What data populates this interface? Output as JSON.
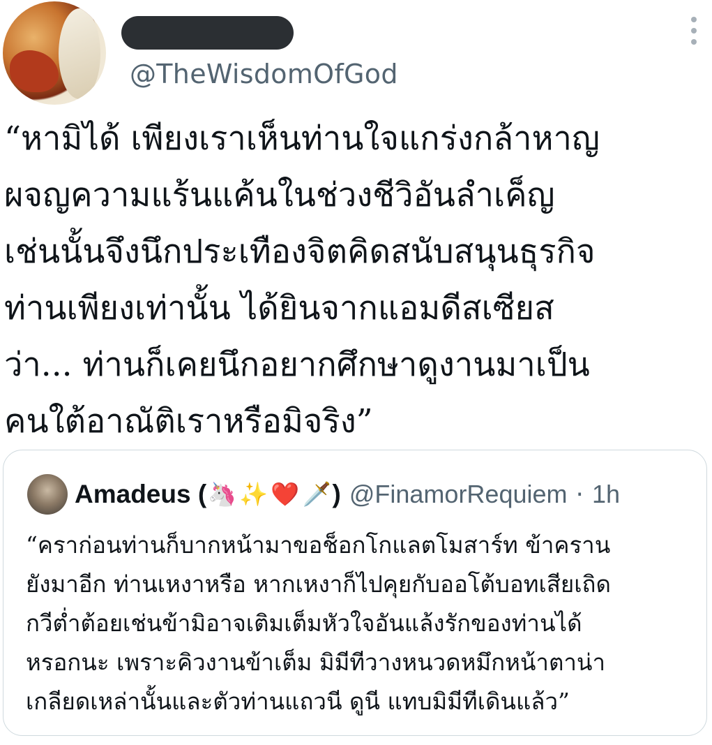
{
  "tweet": {
    "author_handle": "@TheWisdomOfGod",
    "text_lines": [
      "“หามิได้ เพียงเราเห็นท่านใจแกร่งกล้าหาญ",
      "ผจญความแร้นแค้นในช่วงชีวิอันลำเค็ญ",
      "เช่นนั้นจึงนึกประเทืองจิตคิดสนับสนุนธุรกิจ",
      "ท่านเพียงเท่านั้น  ได้ยินจากแอมดีสเซียส",
      "ว่า... ท่านก็เคยนึกอยากศึกษาดูงานมาเป็น",
      "คนใต้อาณัติเราหรือมิจริง”"
    ],
    "more_icon": "more-vertical-icon"
  },
  "quote": {
    "author_name": "Amadeus (",
    "emojis": [
      "🦄",
      "✨",
      "❤️",
      "🗡️"
    ],
    "name_suffix": ")",
    "author_handle": "@FinamorRequiem",
    "separator": "·",
    "time": "1h",
    "text_lines": [
      "“คราก่อนท่านก็บากหน้ามาขอช็อกโกแลตโมสาร์ท ข้าคราน",
      "ยังมาอีก ท่านเหงาหรือ หากเหงาก็ไปคุยกับออโต้บอทเสียเถิด",
      "กวีต่ำต้อยเช่นข้ามิอาจเติมเต็มหัวใจอันแล้งรักของท่านได้",
      "หรอกนะ เพราะคิวงานข้าเต็ม มิมีทีวางหนวดหมึกหน้าตาน่า",
      "เกลียดเหล่านั้นและตัวท่านแถวนี ดูนี แทบมิมีทีเดินแล้ว”"
    ]
  },
  "colors": {
    "text": "#0f1419",
    "secondary": "#536471",
    "border": "#cfd9de"
  }
}
